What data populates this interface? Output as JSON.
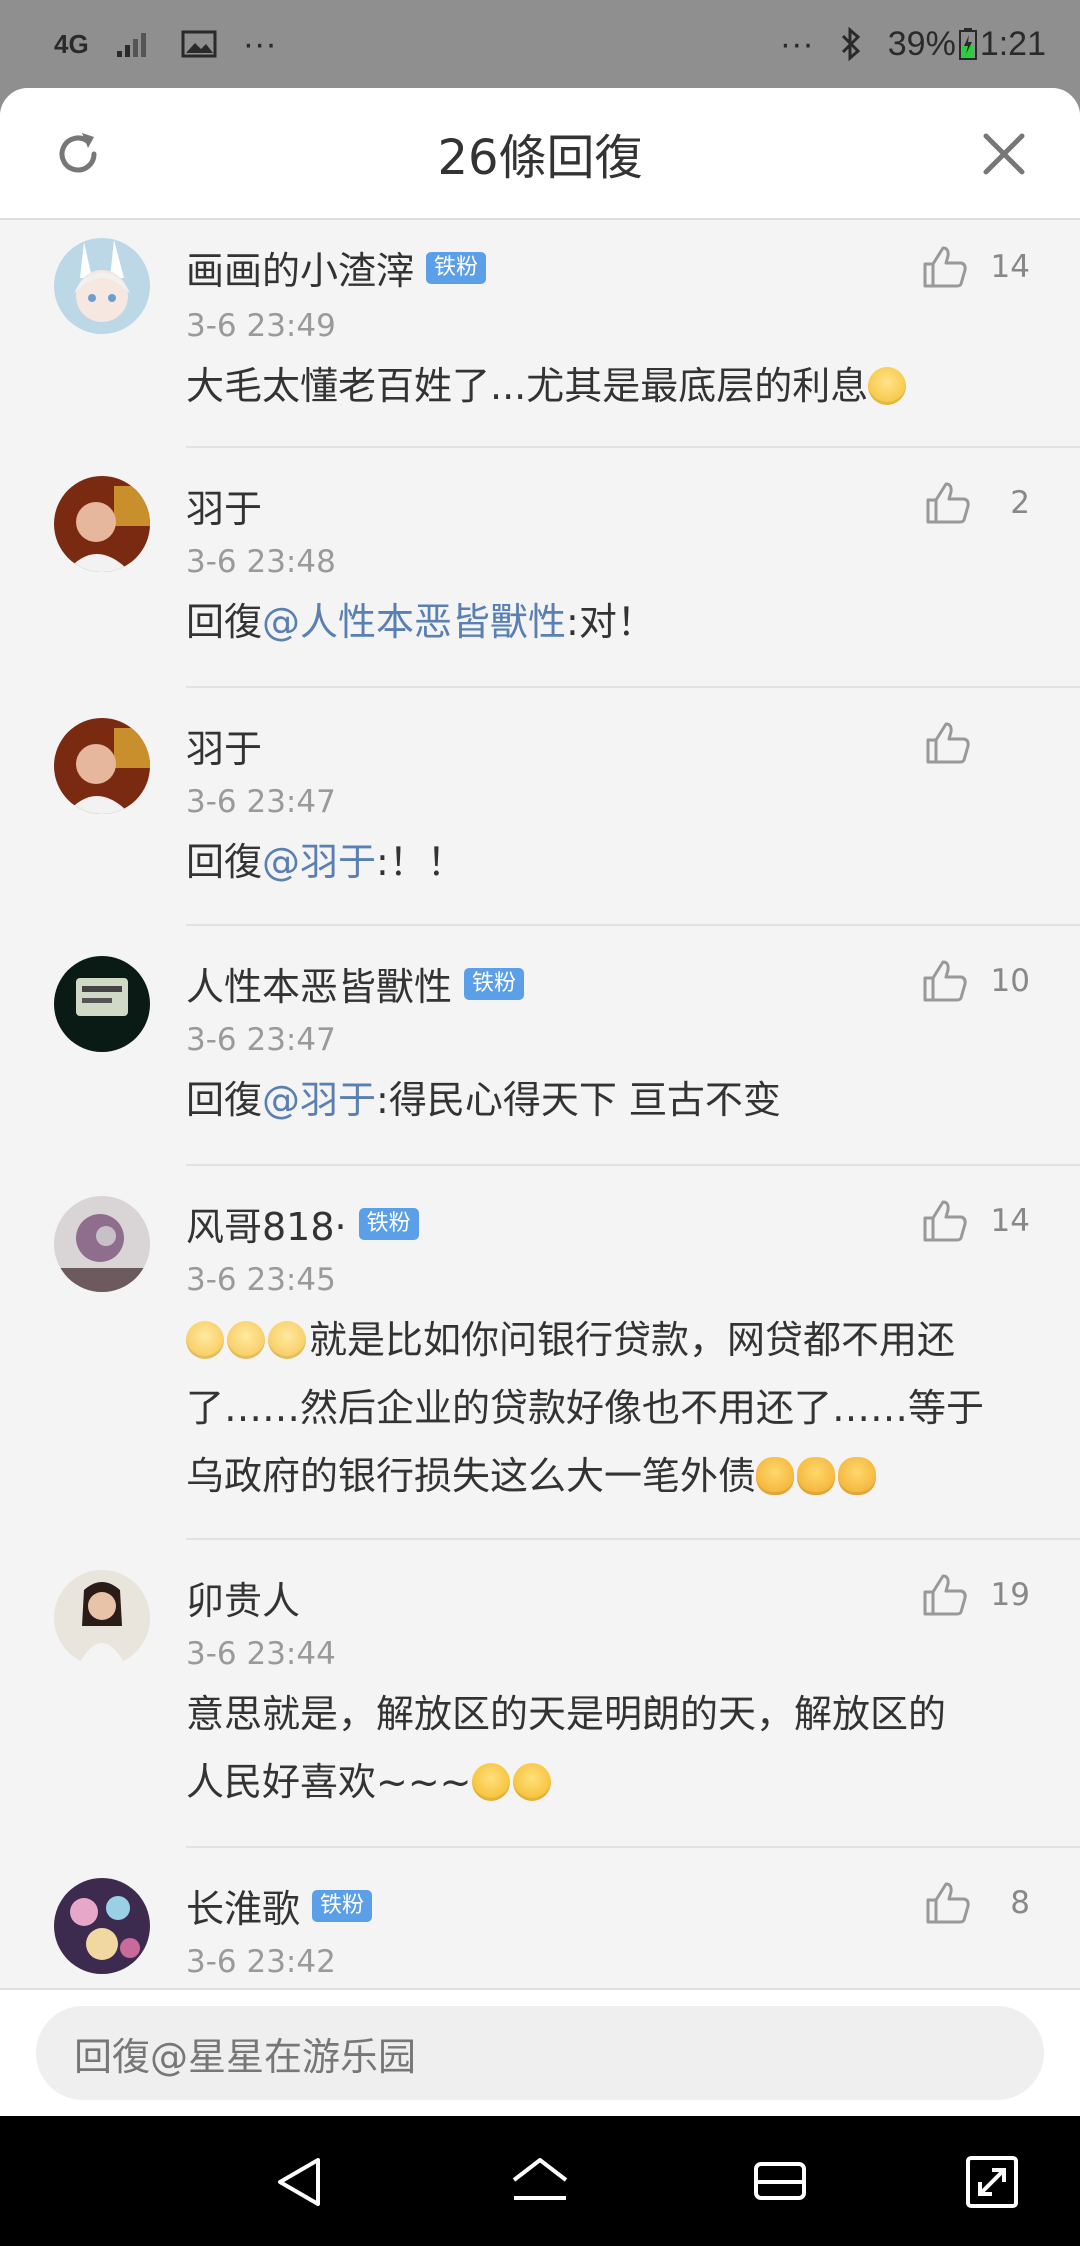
{
  "status_bar": {
    "network": "4G",
    "more_left": "···",
    "more_right": "···",
    "battery": "39%",
    "time": "1:21"
  },
  "sheet": {
    "title": "26條回復"
  },
  "comments": [
    {
      "name": "画画的小渣滓",
      "badge": "铁粉",
      "time": "3-6 23:49",
      "likes": "14",
      "text": "大毛太懂老百姓了...尤其是最底层的利息"
    },
    {
      "name": "羽于",
      "time": "3-6 23:48",
      "likes": "2",
      "reply_prefix": "回復",
      "mention": "@人性本恶皆獸性",
      "text": ":对！"
    },
    {
      "name": "羽于",
      "time": "3-6 23:47",
      "likes": "",
      "reply_prefix": "回復",
      "mention": "@羽于",
      "text": ":！！"
    },
    {
      "name": "人性本恶皆獸性",
      "badge": "铁粉",
      "time": "3-6 23:47",
      "likes": "10",
      "reply_prefix": "回復",
      "mention": "@羽于",
      "text": ":得民心得天下 亘古不变"
    },
    {
      "name": "风哥818·",
      "badge": "铁粉",
      "time": "3-6 23:45",
      "likes": "14",
      "line1": "就是比如你问银行贷款，网贷都不用还",
      "line2": "了……然后企业的贷款好像也不用还了……等于",
      "line3": "乌政府的银行损失这么大一笔外债"
    },
    {
      "name": "卯贵人",
      "time": "3-6 23:44",
      "likes": "19",
      "line1": "意思就是，解放区的天是明朗的天，解放区的",
      "line2": "人民好喜欢~~~"
    },
    {
      "name": "长淮歌",
      "badge": "铁粉",
      "time": "3-6 23:42",
      "likes": "8"
    }
  ],
  "input": {
    "placeholder": "回復@星星在游乐园"
  },
  "icons": {
    "refresh": "refresh-icon",
    "close": "close-icon",
    "like": "thumbs-up-icon",
    "back": "back-triangle-icon",
    "home": "home-icon",
    "recents": "recents-icon",
    "expand": "expand-icon"
  },
  "colors": {
    "mention": "#5a7fb2",
    "badge": "#5a9fe8",
    "status_bar_bg": "#8f8f8f",
    "sheet_bg": "#f4f4f4"
  }
}
